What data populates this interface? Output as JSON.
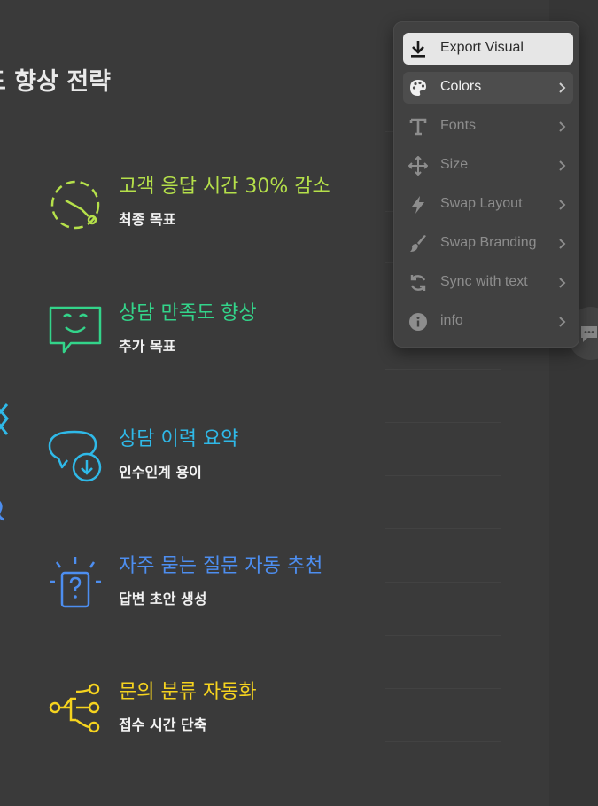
{
  "slide": {
    "title": "도 향상 전략",
    "features": [
      {
        "title": "고객 응답 시간 30% 감소",
        "subtitle": "최종 목표",
        "color": "#b5e04a",
        "icon": "clock-dashed-icon"
      },
      {
        "title": "상담 만족도 향상",
        "subtitle": "추가 목표",
        "color": "#33d48a",
        "icon": "smile-chat-icon"
      },
      {
        "title": "상담 이력 요약",
        "subtitle": "인수인계 용이",
        "color": "#2fb9e8",
        "icon": "chat-download-icon"
      },
      {
        "title": "자주 묻는 질문 자동 추천",
        "subtitle": "답변 초안 생성",
        "color": "#4d8ef0",
        "icon": "question-box-icon"
      },
      {
        "title": "문의 분류 자동화",
        "subtitle": "접수 시간 단축",
        "color": "#f5d31f",
        "icon": "branch-flow-icon"
      }
    ]
  },
  "menu": {
    "items": [
      {
        "label": "Export Visual",
        "icon": "download-icon",
        "chevron": false,
        "state": "primary"
      },
      {
        "label": "Colors",
        "icon": "palette-icon",
        "chevron": true,
        "state": "hover"
      },
      {
        "label": "Fonts",
        "icon": "text-t-icon",
        "chevron": true,
        "state": "normal"
      },
      {
        "label": "Size",
        "icon": "move-arrows-icon",
        "chevron": true,
        "state": "normal"
      },
      {
        "label": "Swap Layout",
        "icon": "lightning-icon",
        "chevron": true,
        "state": "normal"
      },
      {
        "label": "Swap Branding",
        "icon": "paint-brush-icon",
        "chevron": true,
        "state": "normal"
      },
      {
        "label": "Sync with text",
        "icon": "sync-icon",
        "chevron": true,
        "state": "normal"
      },
      {
        "label": "info",
        "icon": "info-icon",
        "chevron": true,
        "state": "normal"
      }
    ]
  },
  "colors": {
    "slide_bg": "#3a3a3a",
    "menu_bg": "#414141",
    "primary_item_bg": "#e6e6e6"
  }
}
